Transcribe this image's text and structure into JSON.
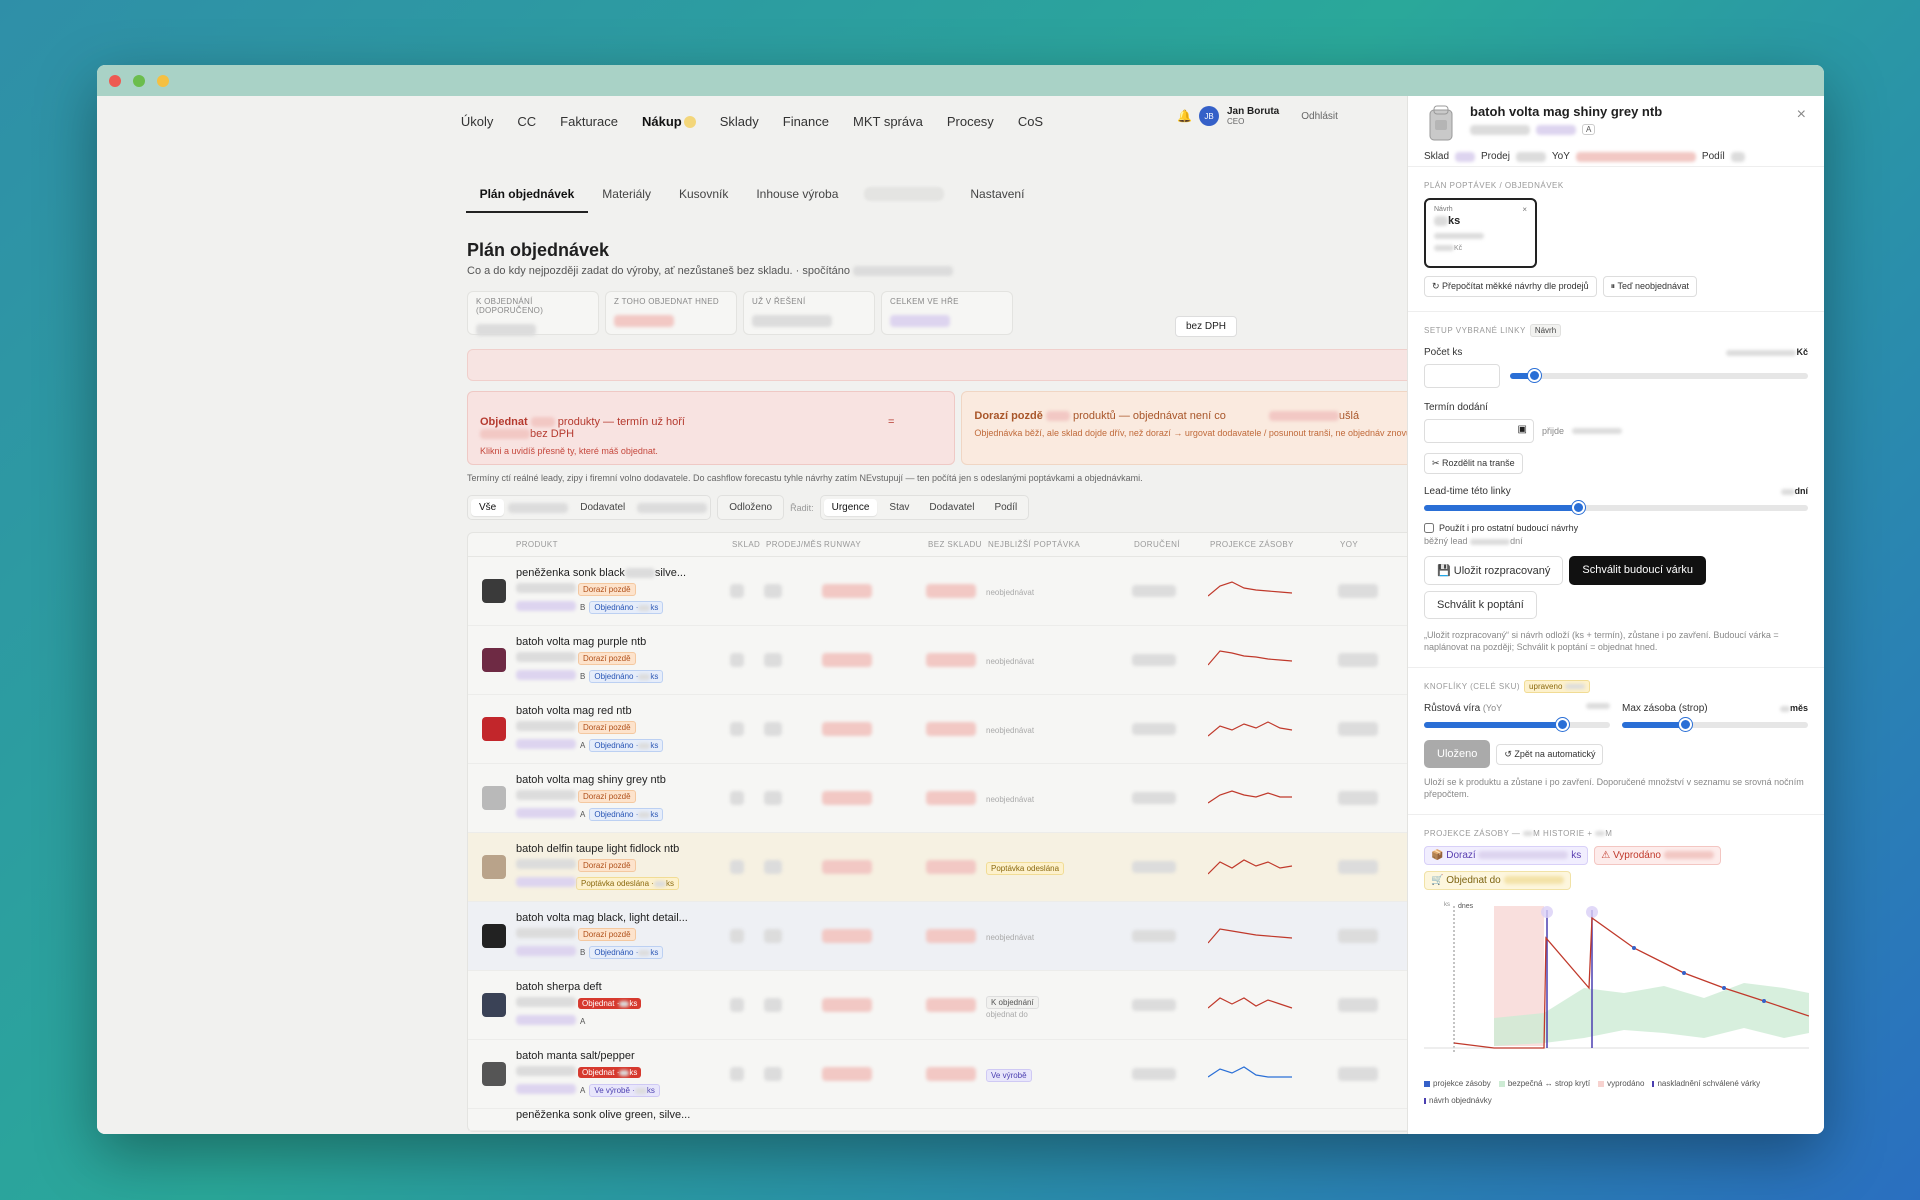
{
  "nav": {
    "items": [
      "Úkoly",
      "CC",
      "Fakturace",
      "Nákup",
      "Sklady",
      "Finance",
      "MKT správa",
      "Procesy",
      "CoS"
    ],
    "active": "Nákup",
    "user_initials": "JB",
    "user_name": "Jan Boruta",
    "user_role": "CEO",
    "logout": "Odhlásit"
  },
  "subtabs": [
    "Plán objednávek",
    "Materiály",
    "Kusovník",
    "Inhouse výroba",
    "Nastavení"
  ],
  "page": {
    "title": "Plán objednávek",
    "subtitle": "Co a do kdy nejpozději zadat do výroby, ať nezůstaneš bez skladu. · spočítáno",
    "kpis": [
      "K OBJEDNÁNÍ (DOPORUČENO)",
      "Z TOHO OBJEDNAT HNED",
      "UŽ V ŘEŠENÍ",
      "CELKEM VE HŘE"
    ],
    "dph": "bez DPH",
    "alert_red": {
      "lead": "Objednat",
      "mid": "produkty — termín už hoří",
      "eq": "=",
      "tail": "bez DPH",
      "sub": "Klikni a uvidíš přesně ty, které máš objednat."
    },
    "alert_orange": {
      "lead": "Dorazí pozdě",
      "mid": "produktů — objednávat není co",
      "tail": "ušlá",
      "sub": "Objednávka běží, ale sklad dojde dřív, než dorazí → urgovat dodavatele / posunout tranši, ne objednáv znovu."
    },
    "note": "Termíny ctí reálné leady, zipy i firemní volno dodavatele. Do cashflow forecastu tyhle návrhy zatím NEvstupují — ten počítá jen s odeslanými poptávkami a objednávkami.",
    "filters": {
      "all": "Vše",
      "supplier": "Dodavatel",
      "postponed": "Odloženo",
      "sort_label": "Řadit:",
      "sorts": [
        "Urgence",
        "Stav",
        "Dodavatel",
        "Podíl"
      ]
    },
    "columns": [
      "PRODUKT",
      "SKLAD",
      "PRODEJ/MĚS",
      "RUNWAY",
      "BEZ SKLADU",
      "NEJBLIŽŠÍ POPTÁVKA",
      "DORUČENÍ",
      "PROJEKCE ZÁSOBY",
      "YOY"
    ],
    "rows": [
      {
        "name": "peněženka sonk black",
        "tail": "silve...",
        "tag": "Dorazí pozdě",
        "tagtype": "late",
        "lvl": "B",
        "status": "Objednáno ·",
        "unit": "ks",
        "poptavka": "neobjednávat",
        "color": "#3a3a3a"
      },
      {
        "name": "batoh volta mag purple ntb",
        "tail": "",
        "tag": "Dorazí pozdě",
        "tagtype": "late",
        "lvl": "B",
        "status": "Objednáno ·",
        "unit": "ks",
        "poptavka": "neobjednávat",
        "color": "#6e2a44"
      },
      {
        "name": "batoh volta mag red ntb",
        "tail": "",
        "tag": "Dorazí pozdě",
        "tagtype": "late",
        "lvl": "A",
        "status": "Objednáno ·",
        "unit": "ks",
        "poptavka": "neobjednávat",
        "color": "#c2262b"
      },
      {
        "name": "batoh volta mag shiny grey ntb",
        "tail": "",
        "tag": "Dorazí pozdě",
        "tagtype": "late",
        "lvl": "A",
        "status": "Objednáno ·",
        "unit": "ks",
        "poptavka": "neobjednávat",
        "color": "#b9b9b9"
      },
      {
        "name": "batoh delfin taupe light fidlock ntb",
        "tail": "",
        "tag": "Dorazí pozdě",
        "tagtype": "late",
        "lvl": "",
        "status": "Poptávka odeslána ·",
        "unit": "ks",
        "poptavka": "Poptávka odeslána",
        "color": "#b9a38a"
      },
      {
        "name": "batoh volta mag black, light detail...",
        "tail": "",
        "tag": "Dorazí pozdě",
        "tagtype": "late",
        "lvl": "B",
        "status": "Objednáno ·",
        "unit": "ks",
        "poptavka": "neobjednávat",
        "color": "#222"
      },
      {
        "name": "batoh sherpa deft",
        "tail": "",
        "tag": "Objednat ·",
        "tagtype": "order",
        "lvl": "A",
        "status": "",
        "unit": "ks",
        "poptavka": "K objednání",
        "poptavka_sub": "objednat do",
        "color": "#3a4256"
      },
      {
        "name": "batoh manta salt/pepper",
        "tail": "",
        "tag": "Objednat ·",
        "tagtype": "order",
        "lvl": "A",
        "status": "Ve výrobě ·",
        "unit": "ks",
        "poptavka": "Ve výrobě",
        "color": "#555"
      }
    ],
    "last_row": "peněženka sonk olive green, silve..."
  },
  "panel": {
    "title": "batoh volta mag shiny grey ntb",
    "badge": "A",
    "meta": [
      "Sklad",
      "Prodej",
      "YoY",
      "Podíl"
    ],
    "sec_plan": "PLÁN POPTÁVEK / OBJEDNÁVEK",
    "draft_label": "Návrh",
    "draft_unit": "ks",
    "draft_currency": "Kč",
    "btn_recalc": "↻ Přepočítat měkké návrhy dle prodejů",
    "btn_pause": "⏸ Teď neobjednávat",
    "sec_setup": "SETUP VYBRANÉ LINKY",
    "setup_badge": "Návrh",
    "qty_label": "Počet ks",
    "qty_right": "Kč",
    "delivery_label": "Termín dodání",
    "arrives": "přijde",
    "btn_split": "✂ Rozdělit na tranše",
    "lead_label": "Lead-time této linky",
    "lead_unit": "dní",
    "checkbox_label": "Použít i pro ostatní budoucí návrhy",
    "normal_lead": "běžný lead",
    "normal_lead_unit": "dní",
    "btn_save_draft": "💾 Uložit rozpracovaný",
    "btn_approve": "Schválit budoucí várku",
    "btn_approve_inq": "Schválit k poptání",
    "save_note": "„Uložit rozpracovaný“ si návrh odloží (ks + termín), zůstane i po zavření. Budoucí várka = naplánovat na později; Schválit k poptání = objednat hned.",
    "sec_knobs": "KNOFLÍKY (CELÉ SKU)",
    "knobs_badge": "upraveno",
    "growth_label": "Růstová víra",
    "growth_hint": "(YoY",
    "max_label": "Max zásoba (strop)",
    "max_unit": "měs",
    "btn_saved": "Uloženo",
    "btn_auto": "↺ Zpět na automatický",
    "knobs_note": "Uloží se k produktu a zůstane i po zavření. Doporučené množství v seznamu se srovná nočním přepočtem.",
    "sec_proj": "PROJEKCE ZÁSOBY — ",
    "sec_proj_mid": "M HISTORIE + ",
    "sec_proj_tail": "M",
    "pill_arrive": "📦 Dorazí",
    "pill_arrive_unit": "ks",
    "pill_sold": "⚠ Vyprodáno",
    "pill_order": "🛒 Objednat do",
    "today": "dnes",
    "y_label": "ks",
    "legend": [
      "projekce zásoby",
      "bezpečná ↔ strop krytí",
      "vyprodáno",
      "naskladnění schválené várky",
      "návrh objednávky"
    ],
    "colors": {
      "projection": "#c0392b",
      "band": "#cdebd4",
      "sold": "#f7d2cf",
      "approved": "#4b3fb0"
    }
  }
}
